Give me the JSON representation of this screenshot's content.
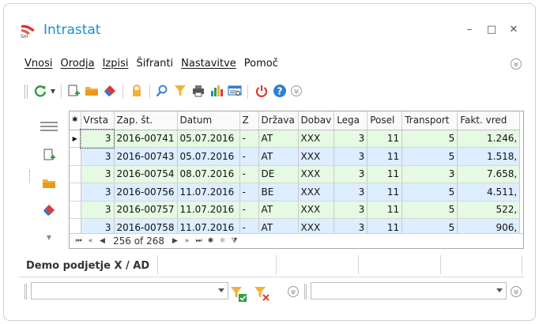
{
  "window": {
    "title": "Intrastat",
    "minimize_glyph": "–",
    "maximize_glyph": "□",
    "close_glyph": "✕"
  },
  "menu": {
    "items": [
      "Vnosi",
      "Orodja",
      "Izpisi",
      "Šifranti",
      "Nastavitve",
      "Pomoč"
    ]
  },
  "icons": {
    "toolbar": [
      "refresh-icon",
      "new-document-icon",
      "open-folder-icon",
      "eraser-icon",
      "lock-icon",
      "search-icon",
      "filter-icon",
      "print-icon",
      "chart-icon",
      "report-icon",
      "power-icon",
      "help-icon",
      "expand-icon"
    ],
    "sidebar": [
      "menu-lines-icon",
      "new-document-icon",
      "open-folder-icon",
      "eraser-icon",
      "chevron-down-icon"
    ]
  },
  "colors": {
    "accent": "#1a8fd6",
    "row_green": "#e6f9e3",
    "row_blue": "#dceeff",
    "refresh": "#2e9e3e",
    "folder": "#f3b135",
    "power": "#e03a2b",
    "help": "#2f7fd0"
  },
  "grid": {
    "columns": [
      "Vrsta",
      "Zap. št.",
      "Datum",
      "Z",
      "Država",
      "Dobav",
      "Lega",
      "Posel",
      "Transport",
      "Fakt. vred"
    ],
    "rows": [
      [
        "3",
        "2016-00741",
        "05.07.2016",
        "-",
        "AT",
        "XXX",
        "3",
        "11",
        "5",
        "1.246,"
      ],
      [
        "3",
        "2016-00743",
        "05.07.2016",
        "-",
        "AT",
        "XXX",
        "3",
        "11",
        "5",
        "1.518,"
      ],
      [
        "3",
        "2016-00754",
        "08.07.2016",
        "-",
        "DE",
        "XXX",
        "3",
        "11",
        "3",
        "7.658,"
      ],
      [
        "3",
        "2016-00756",
        "11.07.2016",
        "-",
        "BE",
        "XXX",
        "3",
        "11",
        "5",
        "4.511,"
      ],
      [
        "3",
        "2016-00757",
        "11.07.2016",
        "-",
        "AT",
        "XXX",
        "3",
        "11",
        "5",
        "522,"
      ],
      [
        "3",
        "2016-00758",
        "11.07.2016",
        "-",
        "AT",
        "XXX",
        "3",
        "11",
        "5",
        "906,"
      ]
    ],
    "row_colors": [
      "green",
      "blue",
      "green",
      "blue",
      "green",
      "blue"
    ],
    "header_glyph": "✱",
    "current_row_glyph": "▶"
  },
  "navigator": {
    "record_text": "256 of 268",
    "buttons": [
      "⏮",
      "«",
      "◀",
      "▶",
      "»",
      "⏭",
      "✱",
      "✱",
      "⧩"
    ]
  },
  "status": {
    "company": "Demo podjetje X / AD"
  },
  "filters": {
    "left_value": "",
    "right_value": ""
  }
}
